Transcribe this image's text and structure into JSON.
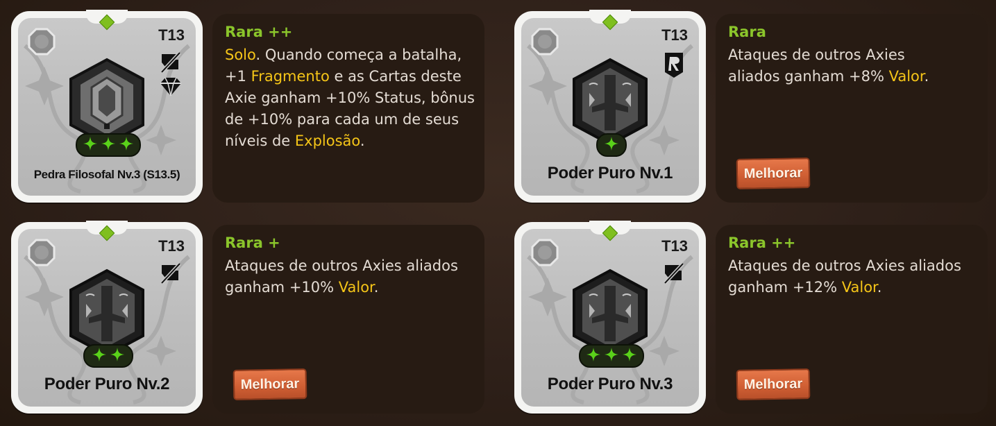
{
  "colors": {
    "rarity": "#8bc52b",
    "highlight": "#f5c518",
    "text": "#e4dcd4",
    "panel": "#271b13",
    "upgrade_button": "#cf5e33"
  },
  "cards": [
    {
      "tier": "T13",
      "name": "Pedra Filosofal Nv.3 (S13.5)",
      "rarity": "Rara ++",
      "level_pluses": 3,
      "tag_icons": [
        "no-attack-icon",
        "diamond-icon"
      ],
      "description": [
        {
          "t": "Solo",
          "h": true
        },
        {
          "t": ". Quando começa a batalha, +1 ",
          "h": false
        },
        {
          "t": "Fragmento",
          "h": true
        },
        {
          "t": " e as Cartas deste Axie ganham +10% Status, bônus de +10% para cada um de seus níveis de ",
          "h": false
        },
        {
          "t": "Explosão",
          "h": true
        },
        {
          "t": ".",
          "h": false
        }
      ],
      "upgrade_label": ""
    },
    {
      "tier": "T13",
      "name": "Poder Puro Nv.1",
      "rarity": "Rara",
      "level_pluses": 1,
      "tag_icons": [
        "ranged-icon"
      ],
      "description": [
        {
          "t": "Ataques de outros Axies aliados ganham +8% ",
          "h": false
        },
        {
          "t": "Valor",
          "h": true
        },
        {
          "t": ".",
          "h": false
        }
      ],
      "upgrade_label": "Melhorar"
    },
    {
      "tier": "T13",
      "name": "Poder Puro Nv.2",
      "rarity": "Rara +",
      "level_pluses": 2,
      "tag_icons": [
        "no-attack-icon"
      ],
      "description": [
        {
          "t": "Ataques de outros Axies aliados ganham +10% ",
          "h": false
        },
        {
          "t": "Valor",
          "h": true
        },
        {
          "t": ".",
          "h": false
        }
      ],
      "upgrade_label": "Melhorar"
    },
    {
      "tier": "T13",
      "name": "Poder Puro Nv.3",
      "rarity": "Rara ++",
      "level_pluses": 3,
      "tag_icons": [
        "no-attack-icon"
      ],
      "description": [
        {
          "t": "Ataques de outros Axies aliados ganham +12% ",
          "h": false
        },
        {
          "t": "Valor",
          "h": true
        },
        {
          "t": ".",
          "h": false
        }
      ],
      "upgrade_label": "Melhorar"
    }
  ]
}
